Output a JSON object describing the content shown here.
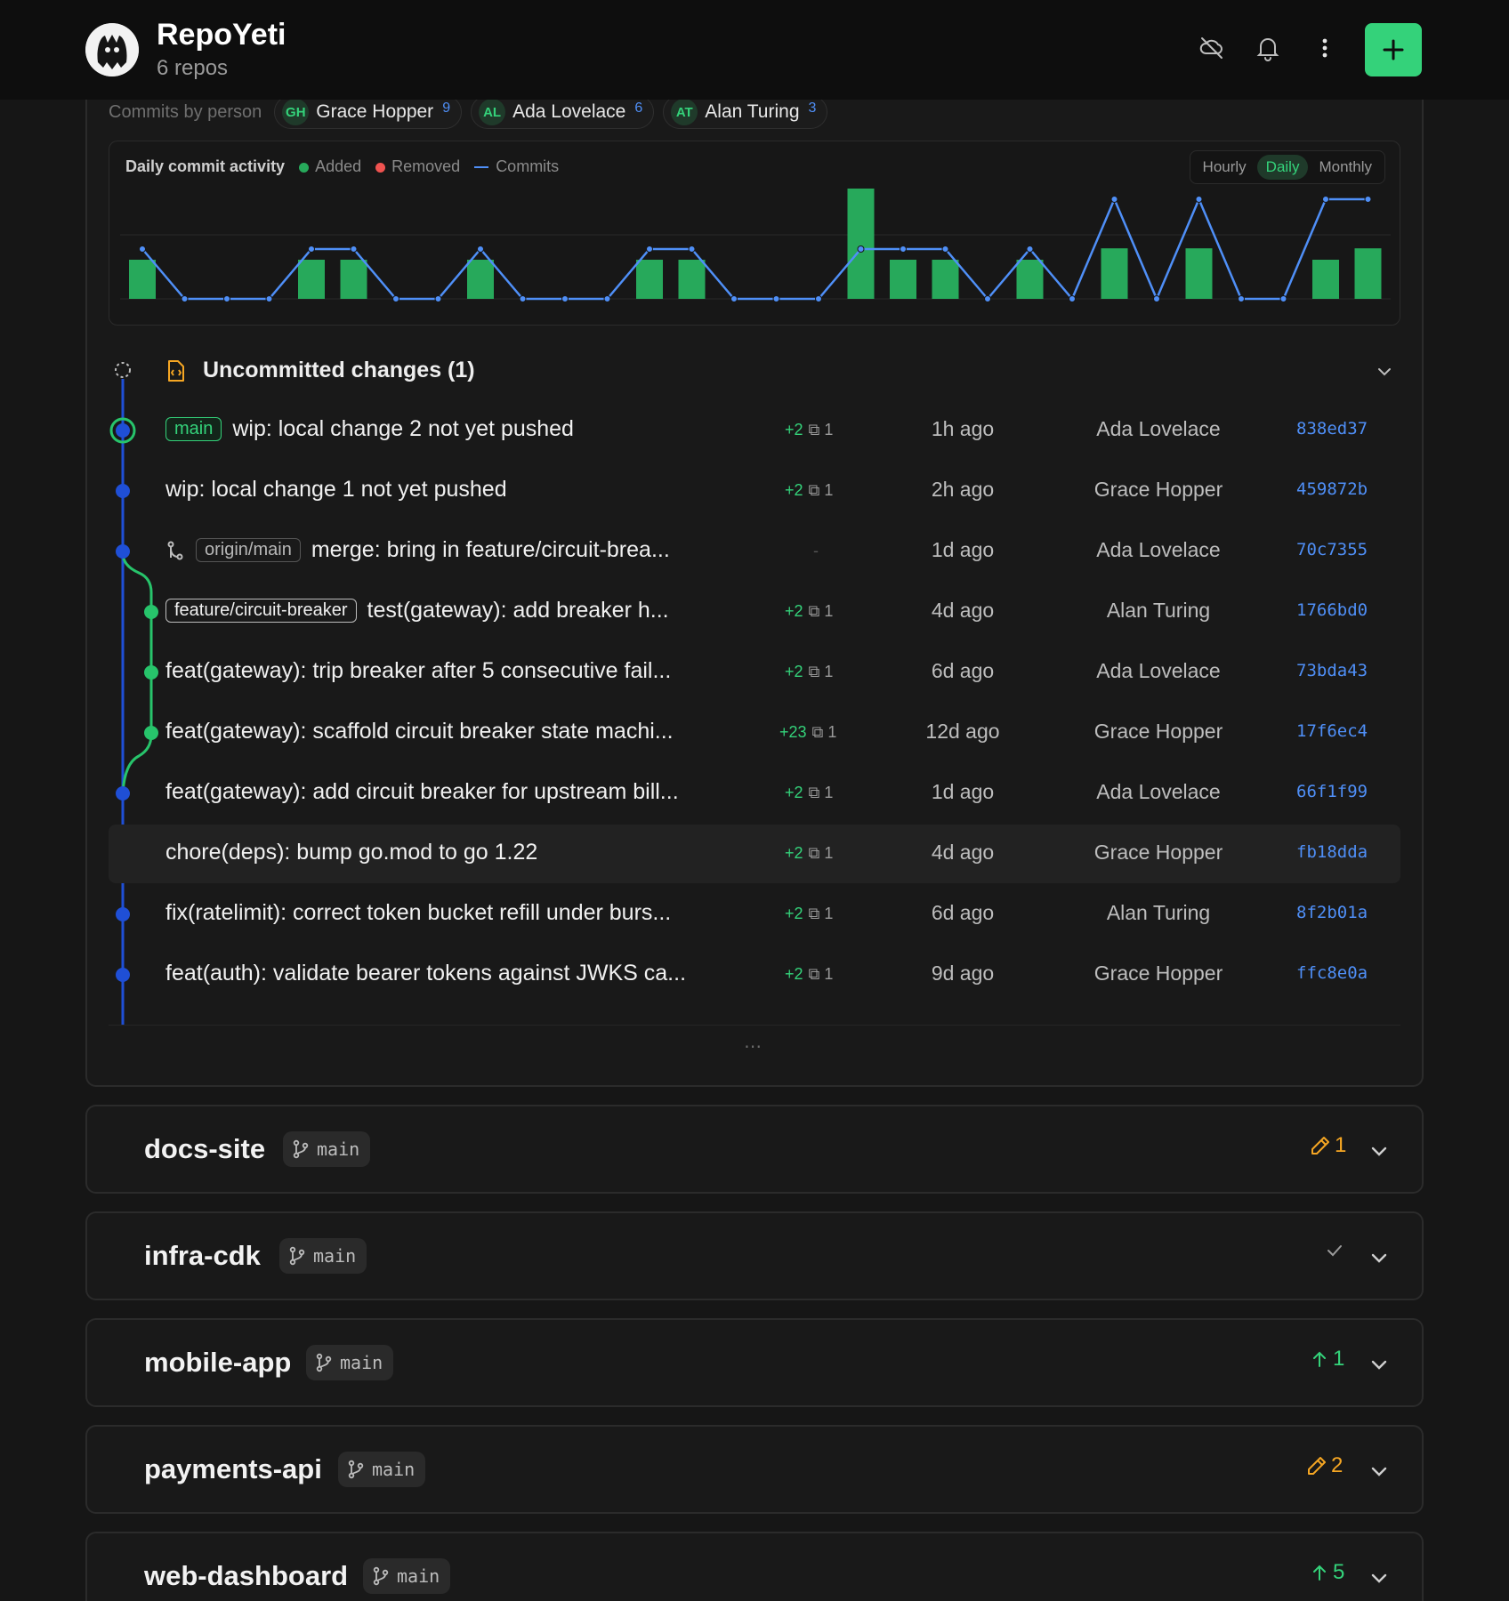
{
  "app": {
    "title": "RepoYeti",
    "subtitle": "6 repos"
  },
  "header_icons": [
    "cloud-off-icon",
    "bell-icon",
    "more-vertical-icon",
    "plus-icon"
  ],
  "persons": {
    "label": "Commits by person",
    "items": [
      {
        "initials": "GH",
        "name": "Grace Hopper",
        "count": "9"
      },
      {
        "initials": "AL",
        "name": "Ada Lovelace",
        "count": "6"
      },
      {
        "initials": "AT",
        "name": "Alan Turing",
        "count": "3"
      }
    ]
  },
  "activity": {
    "title": "Daily commit activity",
    "legend": {
      "added": "Added",
      "removed": "Removed",
      "commits": "Commits"
    },
    "ranges": [
      "Hourly",
      "Daily",
      "Monthly"
    ],
    "active_range": "Daily"
  },
  "chart_data": {
    "type": "bar",
    "series": [
      {
        "name": "Added",
        "values": [
          1,
          0,
          0,
          0,
          1,
          1,
          0,
          0,
          1,
          0,
          0,
          0,
          1,
          1,
          0,
          0,
          0,
          3.5,
          1,
          1,
          0,
          1,
          0,
          1.4,
          0,
          1.4,
          0,
          0,
          1,
          1.4
        ]
      },
      {
        "name": "Commits",
        "values": [
          1,
          0,
          0,
          0,
          1,
          1,
          0,
          0,
          1,
          0,
          0,
          0,
          1,
          1,
          0,
          0,
          0,
          1,
          1,
          1,
          0,
          1,
          0,
          2,
          0,
          2,
          0,
          0,
          2,
          2
        ]
      }
    ],
    "colors": {
      "added": "#27a95b",
      "removed": "#ef5350",
      "commits": "#4f8ff7"
    }
  },
  "uncommitted": {
    "title": "Uncommitted changes (1)"
  },
  "commits": [
    {
      "tag": "main",
      "tag_style": "g",
      "message": "wip: local change 2 not yet pushed",
      "stat": "+2",
      "files": "1",
      "time": "1h ago",
      "author": "Ada Lovelace",
      "sha": "838ed37"
    },
    {
      "tag": "",
      "tag_style": "",
      "message": "wip: local change 1 not yet pushed",
      "stat": "+2",
      "files": "1",
      "time": "2h ago",
      "author": "Grace Hopper",
      "sha": "459872b"
    },
    {
      "tag": "origin/main",
      "tag_style": "o",
      "message": "merge: bring in feature/circuit-brea...",
      "stat": "",
      "files": "",
      "stat_empty": "-",
      "time": "1d ago",
      "author": "Ada Lovelace",
      "sha": "70c7355"
    },
    {
      "tag": "feature/circuit-breaker",
      "tag_style": "w",
      "message": "test(gateway): add breaker h...",
      "stat": "+2",
      "files": "1",
      "time": "4d ago",
      "author": "Alan Turing",
      "sha": "1766bd0"
    },
    {
      "tag": "",
      "tag_style": "",
      "message": "feat(gateway): trip breaker after 5 consecutive fail...",
      "stat": "+2",
      "files": "1",
      "time": "6d ago",
      "author": "Ada Lovelace",
      "sha": "73bda43"
    },
    {
      "tag": "",
      "tag_style": "",
      "message": "feat(gateway): scaffold circuit breaker state machi...",
      "stat": "+23",
      "files": "1",
      "time": "12d ago",
      "author": "Grace Hopper",
      "sha": "17f6ec4"
    },
    {
      "tag": "",
      "tag_style": "",
      "message": "feat(gateway): add circuit breaker for upstream bill...",
      "stat": "+2",
      "files": "1",
      "time": "1d ago",
      "author": "Ada Lovelace",
      "sha": "66f1f99"
    },
    {
      "tag": "",
      "tag_style": "",
      "message": "chore(deps): bump go.mod to go 1.22",
      "stat": "+2",
      "files": "1",
      "time": "4d ago",
      "author": "Grace Hopper",
      "sha": "fb18dda"
    },
    {
      "tag": "",
      "tag_style": "",
      "message": "fix(ratelimit): correct token bucket refill under burs...",
      "stat": "+2",
      "files": "1",
      "time": "6d ago",
      "author": "Alan Turing",
      "sha": "8f2b01a"
    },
    {
      "tag": "",
      "tag_style": "",
      "message": "feat(auth): validate bearer tokens against JWKS ca...",
      "stat": "+2",
      "files": "1",
      "time": "9d ago",
      "author": "Grace Hopper",
      "sha": "ffc8e0a"
    }
  ],
  "repos": [
    {
      "name": "docs-site",
      "branch": "main",
      "status_icon": "pencil-icon",
      "status_value": "1",
      "status_color": "#f5a623"
    },
    {
      "name": "infra-cdk",
      "branch": "main",
      "status_icon": "check-icon",
      "status_value": "",
      "status_color": "#9a9a9a"
    },
    {
      "name": "mobile-app",
      "branch": "main",
      "status_icon": "arrow-up-icon",
      "status_value": "1",
      "status_color": "#34d27a"
    },
    {
      "name": "payments-api",
      "branch": "main",
      "status_icon": "pencil-icon",
      "status_value": "2",
      "status_color": "#f5a623"
    },
    {
      "name": "web-dashboard",
      "branch": "main",
      "status_icon": "arrow-up-icon",
      "status_value": "5",
      "status_color": "#34d27a"
    }
  ]
}
